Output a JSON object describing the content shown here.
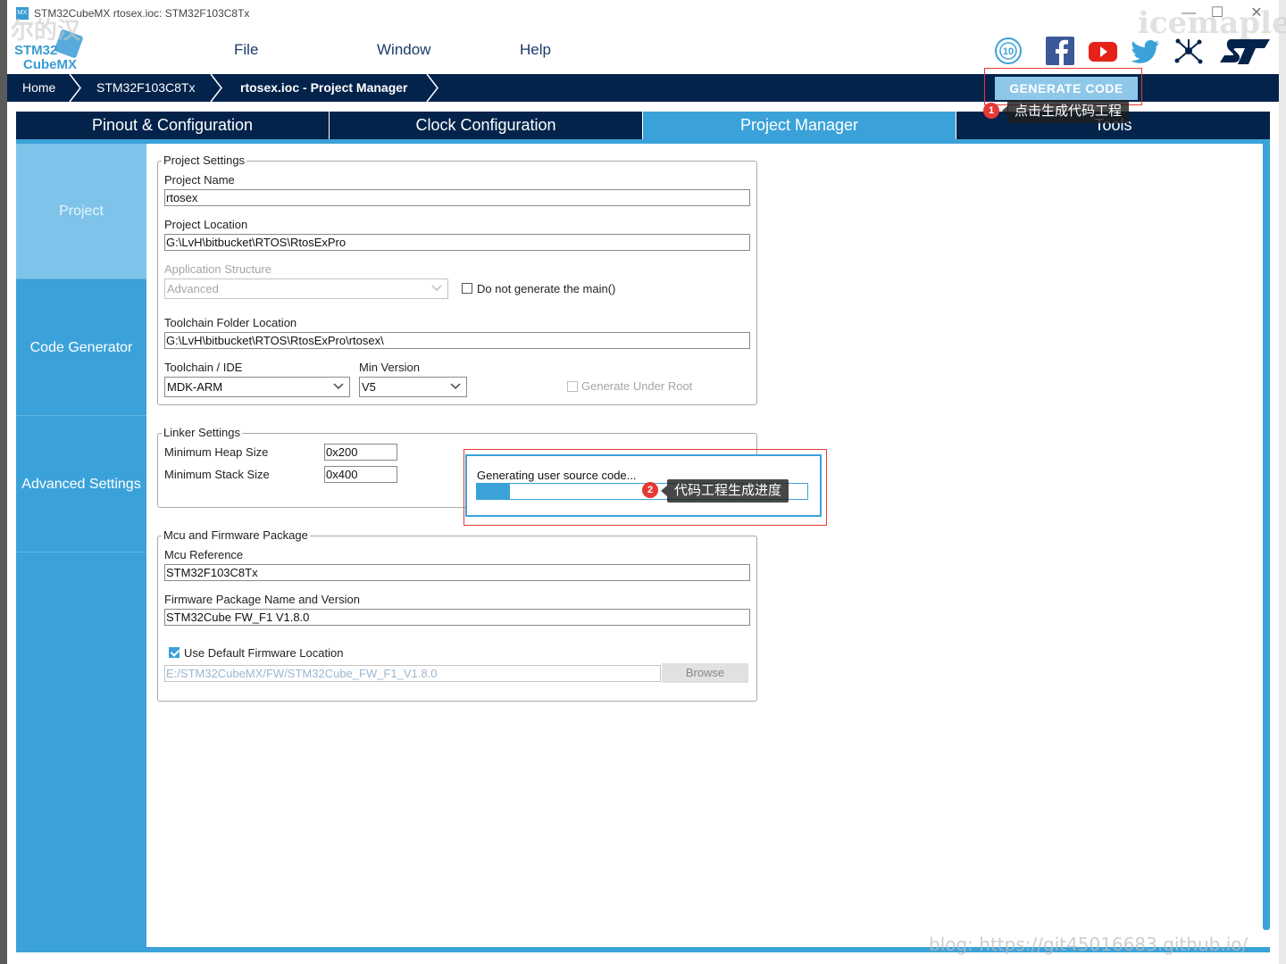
{
  "window": {
    "title": "STM32CubeMX rtosex.ioc: STM32F103C8Tx",
    "minimize": "—",
    "maximize": "☐",
    "close": "✕"
  },
  "logo": {
    "line1": "STM32",
    "line2": "CubeMX"
  },
  "menu": [
    "File",
    "Window",
    "Help"
  ],
  "social_icons": [
    "10-year-anniversary-icon",
    "facebook-icon",
    "youtube-icon",
    "twitter-icon",
    "network-icon",
    "st-logo-icon"
  ],
  "breadcrumb": {
    "items": [
      "Home",
      "STM32F103C8Tx",
      "rtosex.ioc - Project Manager"
    ]
  },
  "generate_button": "GENERATE CODE",
  "tabs": [
    "Pinout & Configuration",
    "Clock Configuration",
    "Project Manager",
    "Tools"
  ],
  "active_tab": "Project Manager",
  "left_nav": [
    "Project",
    "Code Generator",
    "Advanced Settings"
  ],
  "active_nav": "Project",
  "project_settings": {
    "title": "Project Settings",
    "project_name_label": "Project Name",
    "project_name": "rtosex",
    "project_location_label": "Project Location",
    "project_location": "G:\\LvH\\bitbucket\\RTOS\\RtosExPro",
    "app_structure_label": "Application Structure",
    "app_structure": "Advanced",
    "no_main_label": "Do not generate the main()",
    "toolchain_folder_label": "Toolchain Folder Location",
    "toolchain_folder": "G:\\LvH\\bitbucket\\RTOS\\RtosExPro\\rtosex\\",
    "toolchain_label": "Toolchain / IDE",
    "toolchain": "MDK-ARM",
    "min_version_label": "Min Version",
    "min_version": "V5",
    "gen_under_root_label": "Generate Under Root"
  },
  "linker_settings": {
    "title": "Linker Settings",
    "heap_label": "Minimum Heap Size",
    "heap": "0x200",
    "stack_label": "Minimum Stack Size",
    "stack": "0x400"
  },
  "mcu_firmware": {
    "title": "Mcu and Firmware Package",
    "mcu_ref_label": "Mcu Reference",
    "mcu_ref": "STM32F103C8Tx",
    "fw_label": "Firmware Package Name and Version",
    "fw": "STM32Cube FW_F1 V1.8.0",
    "use_default_label": "Use Default Firmware Location",
    "fw_path": "E:/STM32CubeMX/FW/STM32Cube_FW_F1_V1.8.0",
    "browse": "Browse"
  },
  "progress_dialog": {
    "text": "Generating user source code...",
    "progress": 0.1
  },
  "annotations": [
    {
      "number": "1",
      "text": "点击生成代码工程"
    },
    {
      "number": "2",
      "text": "代码工程生成进度"
    }
  ],
  "watermarks": {
    "top_right": "icemaple",
    "top_left": "尔的汉",
    "bottom": "blog: https://git45016683.github.io/"
  },
  "colors": {
    "navy": "#03234b",
    "accent": "#3ba2d9",
    "accent_light": "#7ec3ea",
    "annotation_red": "#e53935"
  }
}
